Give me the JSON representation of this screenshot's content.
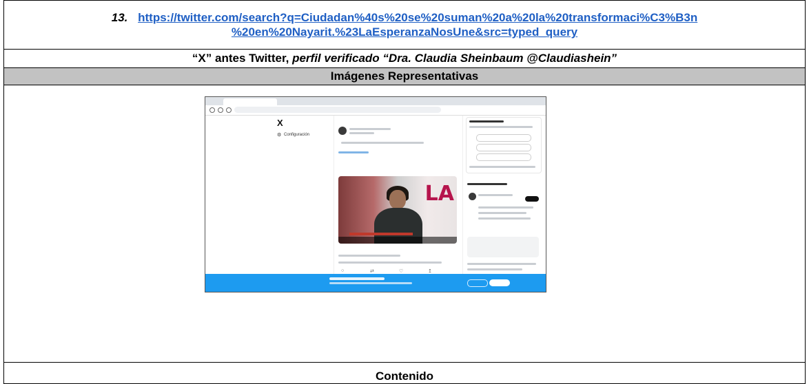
{
  "entry": {
    "number": "13.",
    "url_line1": "https://twitter.com/search?q=Ciudadan%40s%20se%20suman%20a%20la%20transformaci%C3%B3n",
    "url_line2": "%20en%20Nayarit.%23LaEsperanzaNosUne&src=typed_query"
  },
  "profile": {
    "prefix": "“X” antes Twitter, ",
    "verified": "perfil verificado “Dra. Claudia Sheinbaum @Claudiashein”"
  },
  "section_images": "Imágenes Representativas",
  "section_content": "Contenido",
  "screenshot": {
    "logo": "X",
    "settings": "Configuración",
    "brand_text": "LA",
    "colors": {
      "twitter_blue": "#1d9bf0",
      "link_blue": "#1f5fc4",
      "header_gray": "#c2c2c2"
    },
    "icons": [
      "gear-icon",
      "video-play-icon",
      "reply-icon",
      "retweet-icon",
      "like-icon",
      "share-icon"
    ]
  }
}
